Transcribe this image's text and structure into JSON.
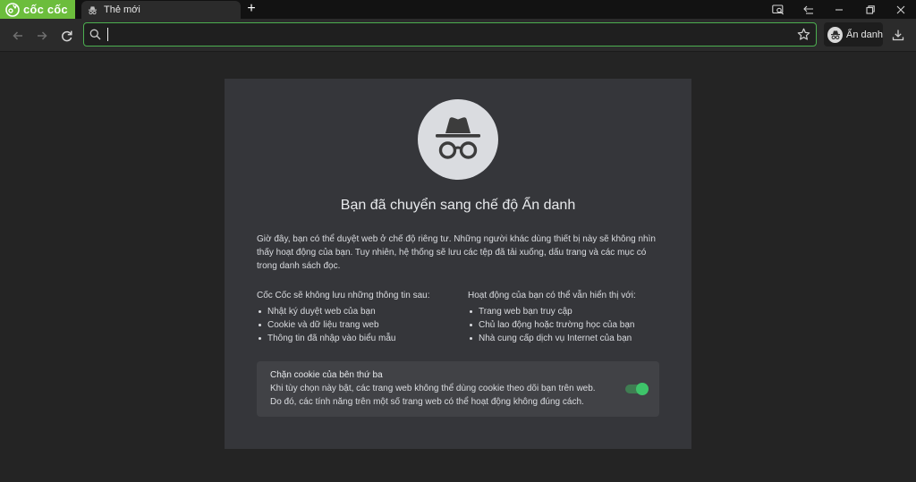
{
  "browser": {
    "brand_name": "cốc cốc",
    "tab_title": "Thẻ mới",
    "new_tab_symbol": "+",
    "omnibox": {
      "value": "",
      "placeholder": ""
    },
    "incognito_label": "Ẩn danh"
  },
  "page": {
    "title": "Bạn đã chuyển sang chế độ Ẩn danh",
    "intro": "Giờ đây, bạn có thể duyệt web ở chế độ riêng tư. Những người khác dùng thiết bị này sẽ không nhìn thấy hoạt động của bạn. Tuy nhiên, hệ thống sẽ lưu các tệp đã tải xuống, dấu trang và các mục có trong danh sách đọc.",
    "not_saved": {
      "heading": "Cốc Cốc sẽ không lưu những thông tin sau:",
      "items": [
        "Nhật ký duyệt web của bạn",
        "Cookie và dữ liệu trang web",
        "Thông tin đã nhập vào biểu mẫu"
      ]
    },
    "visible_to": {
      "heading": "Hoạt động của bạn có thể vẫn hiển thị với:",
      "items": [
        "Trang web bạn truy cập",
        "Chủ lao động hoặc trường học của bạn",
        "Nhà cung cấp dịch vụ Internet của bạn"
      ]
    },
    "cookie_block": {
      "title": "Chặn cookie của bên thứ ba",
      "line1": "Khi tùy chọn này bật, các trang web không thể dùng cookie theo dõi bạn trên web.",
      "line2": "Do đó, các tính năng trên một số trang web có thể hoạt động không đúng cách.",
      "enabled": true
    }
  },
  "icons": {
    "brand": "coccoc-logo-icon",
    "tab": "incognito-icon",
    "titlebar": [
      "tab-search-icon",
      "sidebar-icon",
      "minimize-icon",
      "restore-icon",
      "close-icon"
    ],
    "toolbar": [
      "back-arrow-icon",
      "forward-arrow-icon",
      "reload-icon",
      "search-icon",
      "star-icon",
      "download-icon"
    ]
  },
  "colors": {
    "brand_green": "#6cbd3c",
    "omnibox_border": "#4caf50",
    "toggle_on": "#3ec46a",
    "background": "#242424",
    "card": "#35363a"
  }
}
